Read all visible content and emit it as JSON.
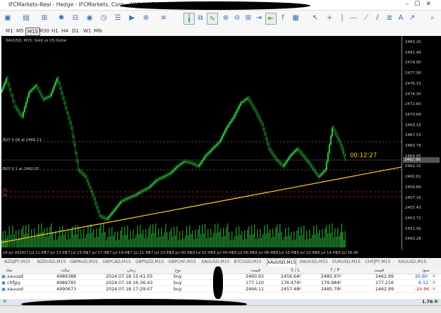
{
  "window": {
    "title": "IFCMarkets-Real - Hedge - IFCMarkets, Corp. - [XAUUSD,M15]"
  },
  "toolbar": {
    "timeframes": [
      "M1",
      "M5",
      "M15",
      "M30",
      "H1",
      "H4",
      "D1",
      "W1",
      "MN"
    ],
    "selected_timeframe": "M15"
  },
  "chart": {
    "header": "XAUUSD, M15: Gold vs US Dollar",
    "countdown": "00:12:27",
    "order_labels": [
      "BUY 0.08 at 2466.11",
      "BUY 0.1 at 2460.93"
    ],
    "sl_labels": [
      "SL",
      "SL"
    ],
    "current_price_badge": "2462.99",
    "price_labels": [
      "2483.20",
      "2481.49",
      "2479.90",
      "2477.99",
      "2476.15",
      "2474.30",
      "2472.60",
      "2470.89",
      "2469.15",
      "2467.53",
      "2465.76",
      "2464.05",
      "2462.32",
      "2460.61",
      "2458.89",
      "2457.16",
      "2455.43",
      "2453.71",
      "2451.99",
      "2450.28"
    ],
    "time_labels": [
      "16 Jul 2024",
      "17 Jul 11:45",
      "17 Jul 13:45",
      "17 Jul 15:45",
      "17 Jul 17:45",
      "17 Jul 19:45",
      "17 Jul 21:45",
      "17 Jul 23:45",
      "18 Jul 00:45",
      "18 Jul 02:45",
      "18 Jul 04:45",
      "18 Jul 06:45",
      "18 Jul 08:45",
      "18 Jul 10:45",
      "18 Jul 12:45",
      "18 Jul 14:45",
      "18 Jul 16:45"
    ]
  },
  "tabs": [
    "NZDJPY,M15",
    "NZDUSD,M15",
    "GBPAUD,M15",
    "GBPCAD,M15",
    "GBPNZD,M15",
    "GBPCHF,M15",
    "XAGUSD,M15",
    "BTCUSD,M15",
    "XAUUSD,M15",
    "XAUUSD,M15",
    "EURUSD,M15",
    "CHFJPY,M15",
    "XAUUSD,M15"
  ],
  "selected_tab_index": 8,
  "trade_table": {
    "headers": {
      "symbol": "نماد",
      "ticket": "تیکت",
      "time": "زمان",
      "type": "نوع",
      "price": "قیمت",
      "sl": "S / L",
      "tp": "T / P",
      "cur_price": "قیمت",
      "profit": "سود"
    },
    "rows": [
      {
        "symbol": "xauusd",
        "ticket": "4989388",
        "time": "2024.07.18 15:41:55",
        "type": "buy",
        "price": "2460.93",
        "sl": "2456.64",
        "tp": "2485.97",
        "cur": "2462.99",
        "profit": "20.60",
        "profit_color": "#1a3fd6"
      },
      {
        "symbol": "chfjpy",
        "ticket": "4989785",
        "time": "2024.07.18 16:36:43",
        "type": "buy",
        "price": "177.120",
        "sl": "176.474",
        "tp": "179.984",
        "cur": "177.216",
        "profit": "6.12",
        "profit_color": "#1a3fd6"
      },
      {
        "symbol": "xauusd",
        "ticket": "4990673",
        "time": "2024.07.18 17:29:07",
        "type": "buy",
        "price": "2466.11",
        "sl": "2457.48",
        "tp": "2485.79",
        "cur": "2462.99",
        "profit": "-24.96",
        "profit_color": "#d60f0f"
      }
    ],
    "total": "1.76"
  }
}
